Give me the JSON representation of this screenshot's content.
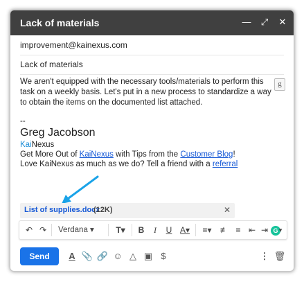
{
  "window": {
    "title": "Lack of materials"
  },
  "to": "improvement@kainexus.com",
  "subject": "Lack of materials",
  "body": "We aren't equipped with the necessary tools/materials to perform this task on a weekly basis. Let's put in a new process to standardize a way to obtain the items on the documented list attached.",
  "signature": {
    "dash": "--",
    "name": "Greg Jacobson",
    "brand_kai": "Kai",
    "brand_nexus": "Nexus",
    "line1_prefix": "Get More Out of ",
    "line1_link1": "KaiNexus",
    "line1_mid": " with Tips from the ",
    "line1_link2": "Customer Blog",
    "line1_suffix": "!",
    "line2_prefix": "Love KaiNexus as much as we do? Tell a friend with a ",
    "line2_link": "referral"
  },
  "attachment": {
    "name": "List of supplies.docx",
    "size": "(12K)"
  },
  "toolbar": {
    "font": "Verdana"
  },
  "send_label": "Send",
  "colors": {
    "titlebar": "#404040",
    "send": "#1a73e8",
    "link": "#1558d6",
    "arrow": "#1aa3e8"
  }
}
